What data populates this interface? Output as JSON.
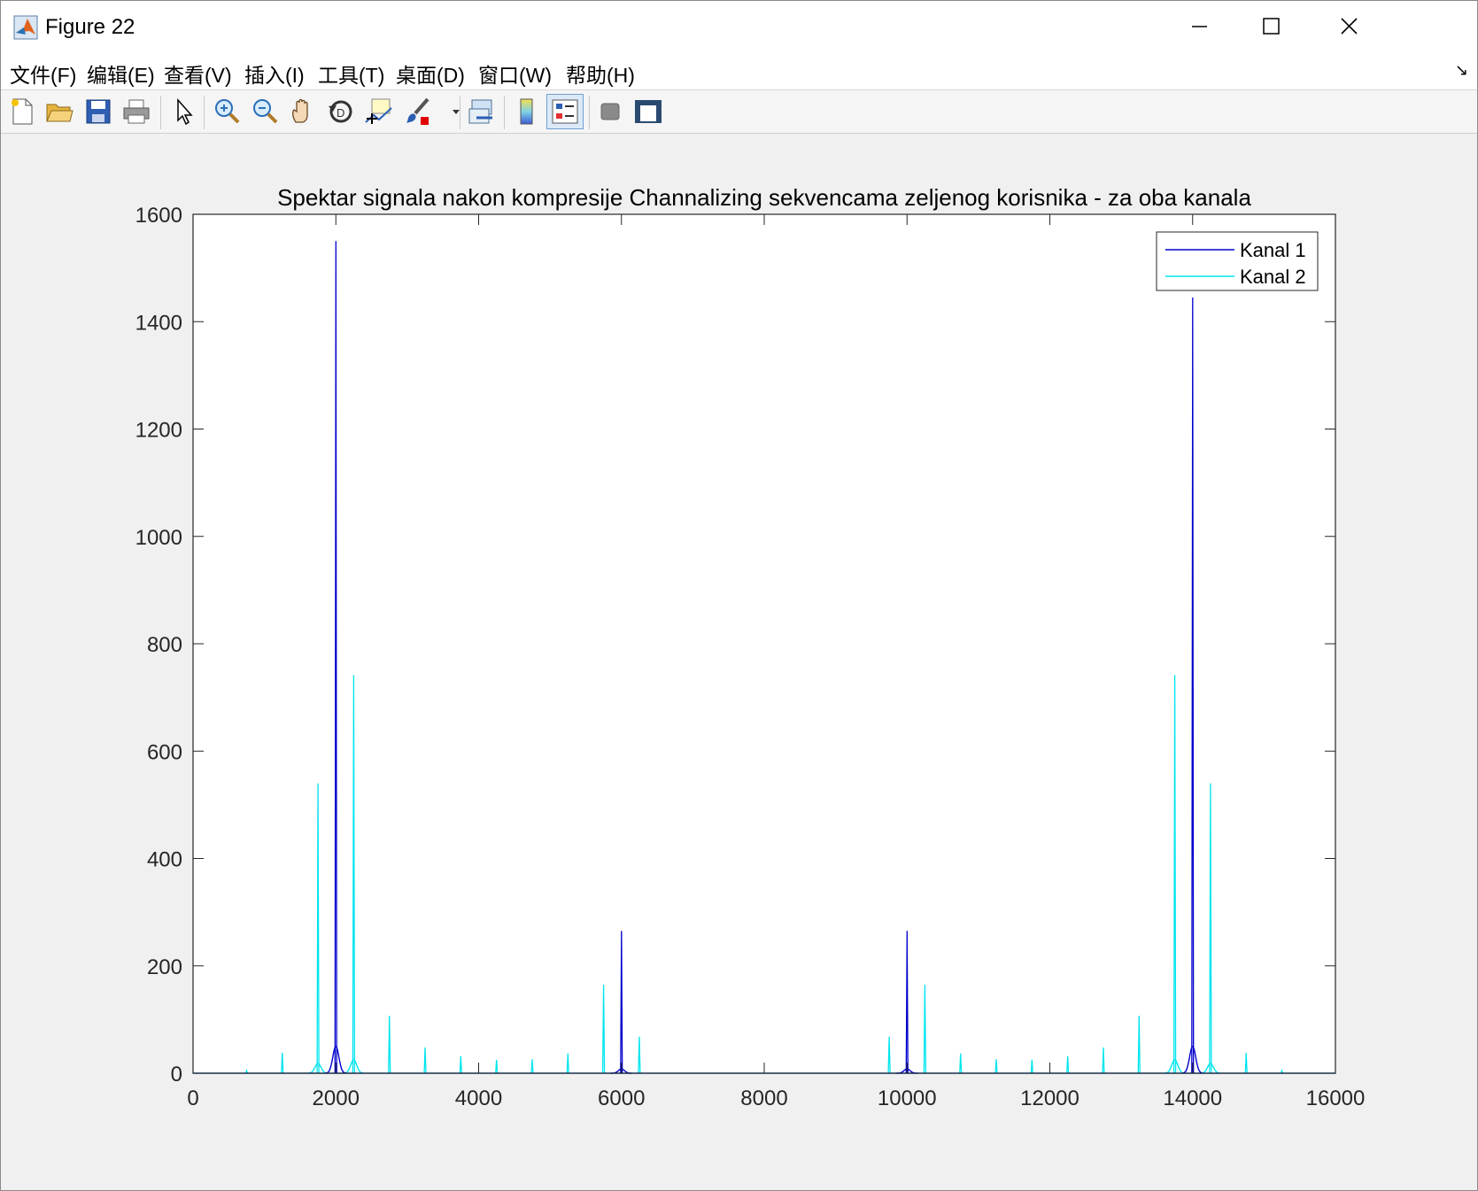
{
  "window": {
    "title": "Figure 22"
  },
  "menu": [
    "文件(F)",
    "编辑(E)",
    "查看(V)",
    "插入(I)",
    "工具(T)",
    "桌面(D)",
    "窗口(W)",
    "帮助(H)"
  ],
  "colors": {
    "kanal1": "#0000cc",
    "kanal2": "#00e5ee",
    "axes_bg": "#ffffff",
    "figure_bg": "#f0f0f0"
  },
  "toolbar_icons": [
    "new-figure-icon",
    "open-file-icon",
    "save-icon",
    "print-icon",
    "pointer-icon",
    "zoom-in-icon",
    "zoom-out-icon",
    "pan-icon",
    "rotate-3d-icon",
    "data-cursor-icon",
    "brush-icon",
    "link-plot-icon",
    "colorbar-icon",
    "legend-icon",
    "hide-plot-tools-icon",
    "show-plot-tools-icon"
  ],
  "chart_data": {
    "type": "line",
    "title": "Spektar signala nakon kompresije Channalizing sekvencama zeljenog korisnika - za oba kanala",
    "xlabel": "",
    "ylabel": "",
    "xlim": [
      0,
      16000
    ],
    "ylim": [
      0,
      1600
    ],
    "xticks": [
      0,
      2000,
      4000,
      6000,
      8000,
      10000,
      12000,
      14000,
      16000
    ],
    "yticks": [
      0,
      200,
      400,
      600,
      800,
      1000,
      1200,
      1400,
      1600
    ],
    "grid": false,
    "legend_position": "top-right",
    "series": [
      {
        "name": "Kanal 1",
        "spikes": [
          [
            2000,
            1550
          ],
          [
            6000,
            265
          ],
          [
            10000,
            265
          ],
          [
            14000,
            1445
          ]
        ],
        "bumps": [
          [
            2000,
            50
          ],
          [
            6000,
            8
          ],
          [
            10000,
            8
          ],
          [
            14000,
            50
          ]
        ]
      },
      {
        "name": "Kanal 2",
        "spikes": [
          [
            750,
            5
          ],
          [
            1250,
            38
          ],
          [
            1750,
            540
          ],
          [
            2250,
            742
          ],
          [
            2750,
            107
          ],
          [
            3250,
            48
          ],
          [
            3750,
            32
          ],
          [
            4250,
            25
          ],
          [
            4750,
            26
          ],
          [
            5250,
            37
          ],
          [
            5750,
            165
          ],
          [
            6250,
            68
          ],
          [
            9750,
            68
          ],
          [
            10250,
            165
          ],
          [
            10750,
            37
          ],
          [
            11250,
            26
          ],
          [
            11750,
            25
          ],
          [
            12250,
            32
          ],
          [
            12750,
            48
          ],
          [
            13250,
            107
          ],
          [
            13750,
            742
          ],
          [
            14250,
            540
          ],
          [
            14750,
            38
          ],
          [
            15250,
            5
          ]
        ],
        "bumps": [
          [
            1750,
            18
          ],
          [
            2250,
            25
          ],
          [
            13750,
            25
          ],
          [
            14250,
            18
          ]
        ]
      }
    ]
  }
}
